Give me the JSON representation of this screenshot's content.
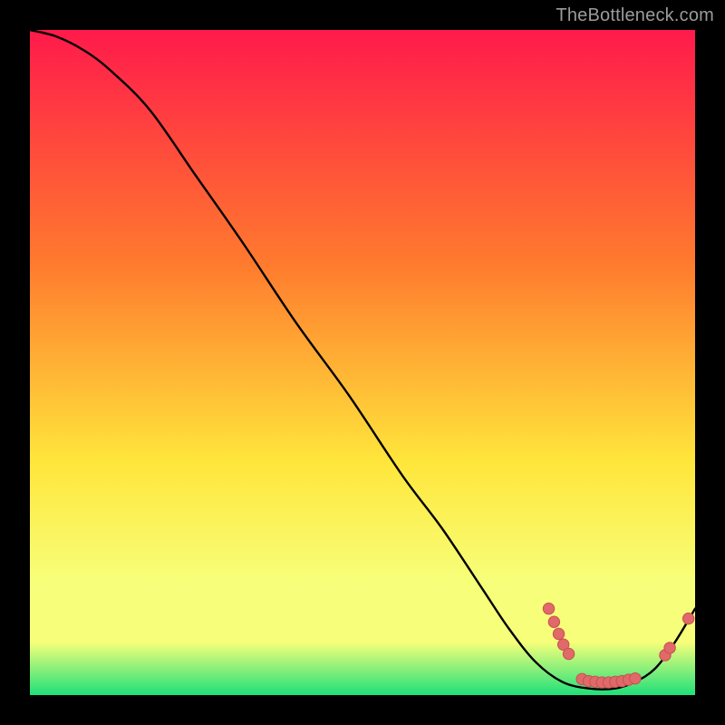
{
  "watermark": "TheBottleneck.com",
  "colors": {
    "background": "#000000",
    "gradient_top": "#ff1a4b",
    "gradient_mid1": "#ff7a2e",
    "gradient_mid2": "#ffe63b",
    "gradient_low": "#f7ff7a",
    "gradient_green": "#1fe07a",
    "curve": "#000000",
    "dot_fill": "#e06a6a",
    "dot_stroke": "#c94f4f"
  },
  "chart_data": {
    "type": "line",
    "xlabel": "",
    "ylabel": "",
    "xlim": [
      0,
      100
    ],
    "ylim": [
      0,
      100
    ],
    "title": "",
    "series": [
      {
        "name": "curve",
        "x": [
          0,
          4,
          8,
          12,
          18,
          25,
          32,
          40,
          48,
          56,
          62,
          68,
          72,
          76,
          80,
          84,
          88,
          91,
          94,
          97,
          100
        ],
        "y": [
          100,
          99,
          97,
          94,
          88,
          78,
          68,
          56,
          45,
          33,
          25,
          16,
          10,
          5,
          2,
          1,
          1,
          2,
          4,
          8,
          13
        ]
      }
    ],
    "dots": [
      {
        "x": 78.0,
        "y": 13.0
      },
      {
        "x": 78.8,
        "y": 11.0
      },
      {
        "x": 79.5,
        "y": 9.2
      },
      {
        "x": 80.2,
        "y": 7.6
      },
      {
        "x": 81.0,
        "y": 6.2
      },
      {
        "x": 83.0,
        "y": 2.4
      },
      {
        "x": 84.0,
        "y": 2.1
      },
      {
        "x": 85.0,
        "y": 2.0
      },
      {
        "x": 86.0,
        "y": 1.9
      },
      {
        "x": 87.0,
        "y": 1.9
      },
      {
        "x": 88.0,
        "y": 2.0
      },
      {
        "x": 89.0,
        "y": 2.1
      },
      {
        "x": 90.0,
        "y": 2.3
      },
      {
        "x": 91.0,
        "y": 2.5
      },
      {
        "x": 95.5,
        "y": 6.0
      },
      {
        "x": 96.2,
        "y": 7.1
      },
      {
        "x": 99.0,
        "y": 11.5
      }
    ]
  }
}
